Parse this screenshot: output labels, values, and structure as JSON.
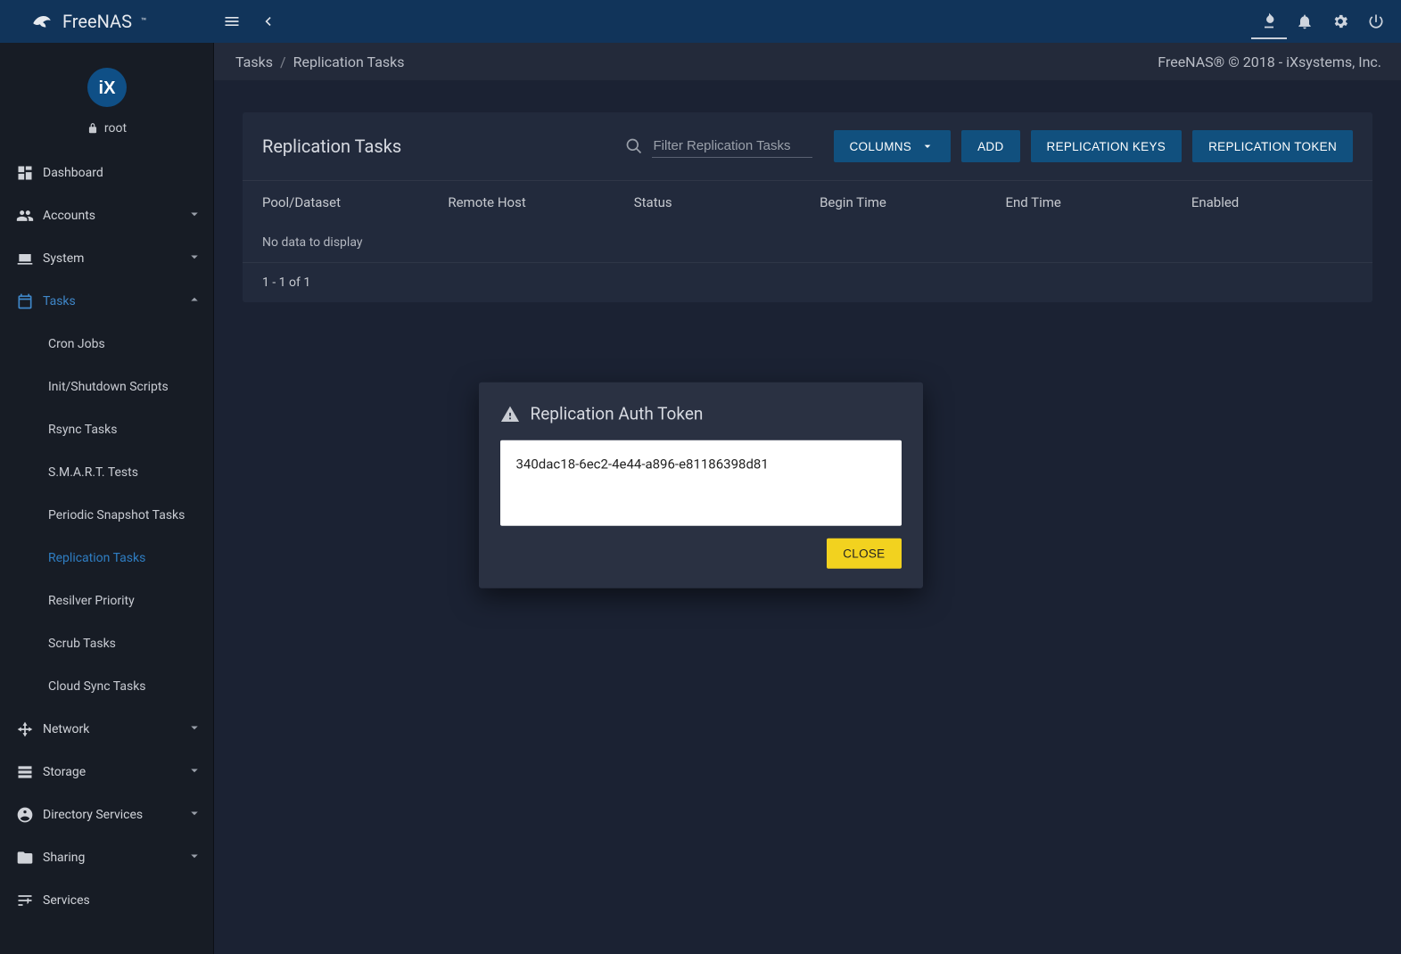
{
  "brand": "FreeNAS",
  "user": {
    "name": "root"
  },
  "breadcrumb": {
    "root": "Tasks",
    "leaf": "Replication Tasks"
  },
  "copyright": "FreeNAS® © 2018 - iXsystems, Inc.",
  "sidebar": {
    "items": [
      {
        "icon": "dashboard",
        "label": "Dashboard",
        "expandable": false
      },
      {
        "icon": "group",
        "label": "Accounts",
        "expandable": true
      },
      {
        "icon": "laptop",
        "label": "System",
        "expandable": true
      },
      {
        "icon": "calendar",
        "label": "Tasks",
        "expandable": true,
        "active": true,
        "children": [
          {
            "label": "Cron Jobs"
          },
          {
            "label": "Init/Shutdown Scripts"
          },
          {
            "label": "Rsync Tasks"
          },
          {
            "label": "S.M.A.R.T. Tests"
          },
          {
            "label": "Periodic Snapshot Tasks"
          },
          {
            "label": "Replication Tasks",
            "current": true
          },
          {
            "label": "Resilver Priority"
          },
          {
            "label": "Scrub Tasks"
          },
          {
            "label": "Cloud Sync Tasks"
          }
        ]
      },
      {
        "icon": "hub",
        "label": "Network",
        "expandable": true
      },
      {
        "icon": "storage",
        "label": "Storage",
        "expandable": true
      },
      {
        "icon": "dirsvc",
        "label": "Directory Services",
        "expandable": true
      },
      {
        "icon": "folder",
        "label": "Sharing",
        "expandable": true
      },
      {
        "icon": "tune",
        "label": "Services",
        "expandable": false
      }
    ]
  },
  "page": {
    "title": "Replication Tasks",
    "search_placeholder": "Filter Replication Tasks",
    "buttons": {
      "columns": "COLUMNS",
      "add": "ADD",
      "keys": "REPLICATION KEYS",
      "token": "REPLICATION TOKEN"
    },
    "columns": [
      "Pool/Dataset",
      "Remote Host",
      "Status",
      "Begin Time",
      "End Time",
      "Enabled"
    ],
    "empty": "No data to display",
    "pager": "1 - 1 of 1"
  },
  "dialog": {
    "title": "Replication Auth Token",
    "token": "340dac18-6ec2-4e44-a896-e81186398d81",
    "close": "CLOSE"
  }
}
